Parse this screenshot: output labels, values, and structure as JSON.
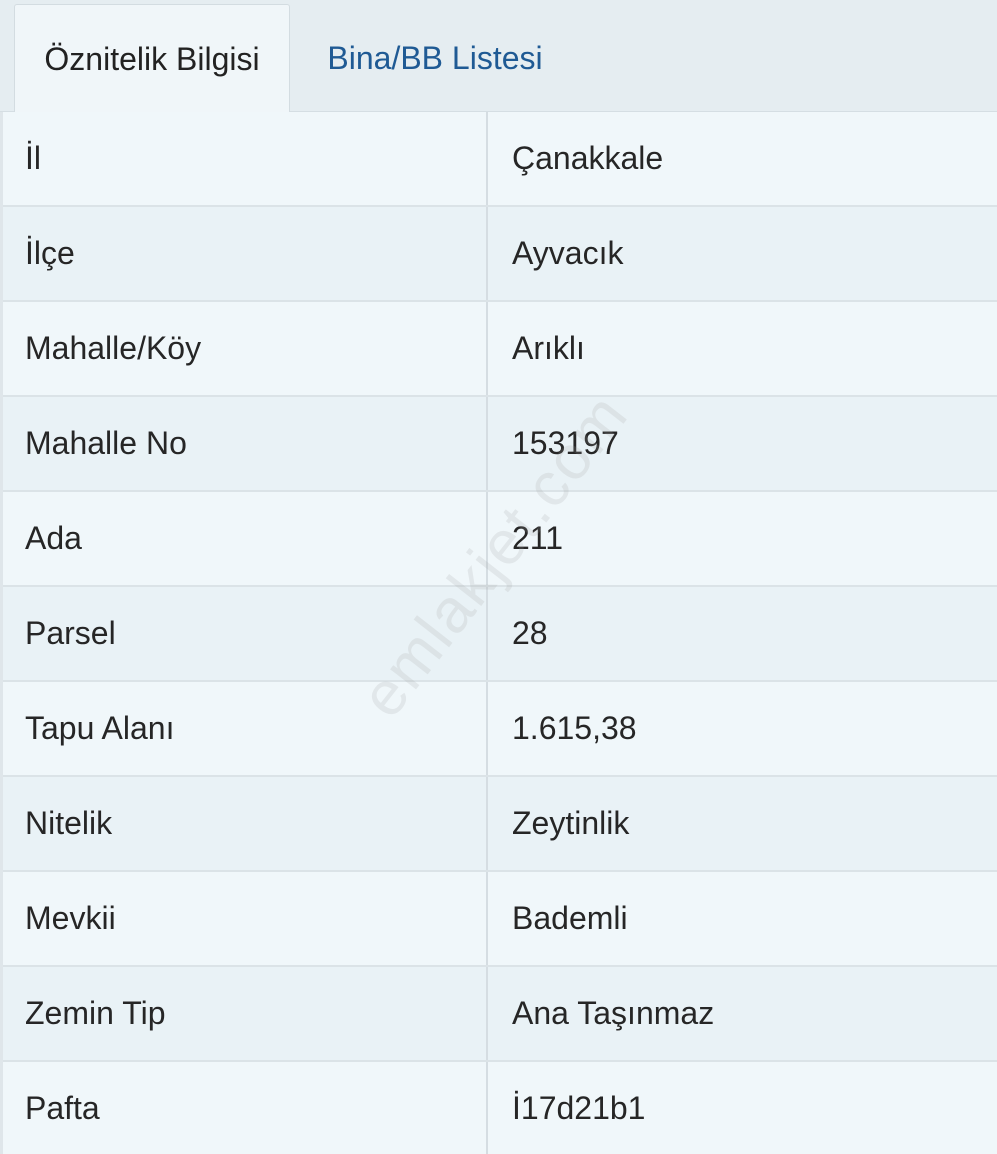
{
  "tabs": [
    {
      "label": "Öznitelik Bilgisi",
      "active": true
    },
    {
      "label": "Bina/BB Listesi",
      "active": false
    }
  ],
  "rows": [
    {
      "key": "İl",
      "value": "Çanakkale"
    },
    {
      "key": "İlçe",
      "value": "Ayvacık"
    },
    {
      "key": "Mahalle/Köy",
      "value": "Arıklı"
    },
    {
      "key": "Mahalle No",
      "value": "153197"
    },
    {
      "key": "Ada",
      "value": "211"
    },
    {
      "key": "Parsel",
      "value": "28"
    },
    {
      "key": "Tapu Alanı",
      "value": "1.615,38"
    },
    {
      "key": "Nitelik",
      "value": "Zeytinlik"
    },
    {
      "key": "Mevkii",
      "value": "Bademli"
    },
    {
      "key": "Zemin Tip",
      "value": "Ana Taşınmaz"
    },
    {
      "key": "Pafta",
      "value": "İ17d21b1"
    }
  ],
  "watermark": "emlakjet.com",
  "colors": {
    "tab_link": "#1f5a94",
    "row_odd": "#f0f7fa",
    "row_even": "#e9f2f6"
  }
}
